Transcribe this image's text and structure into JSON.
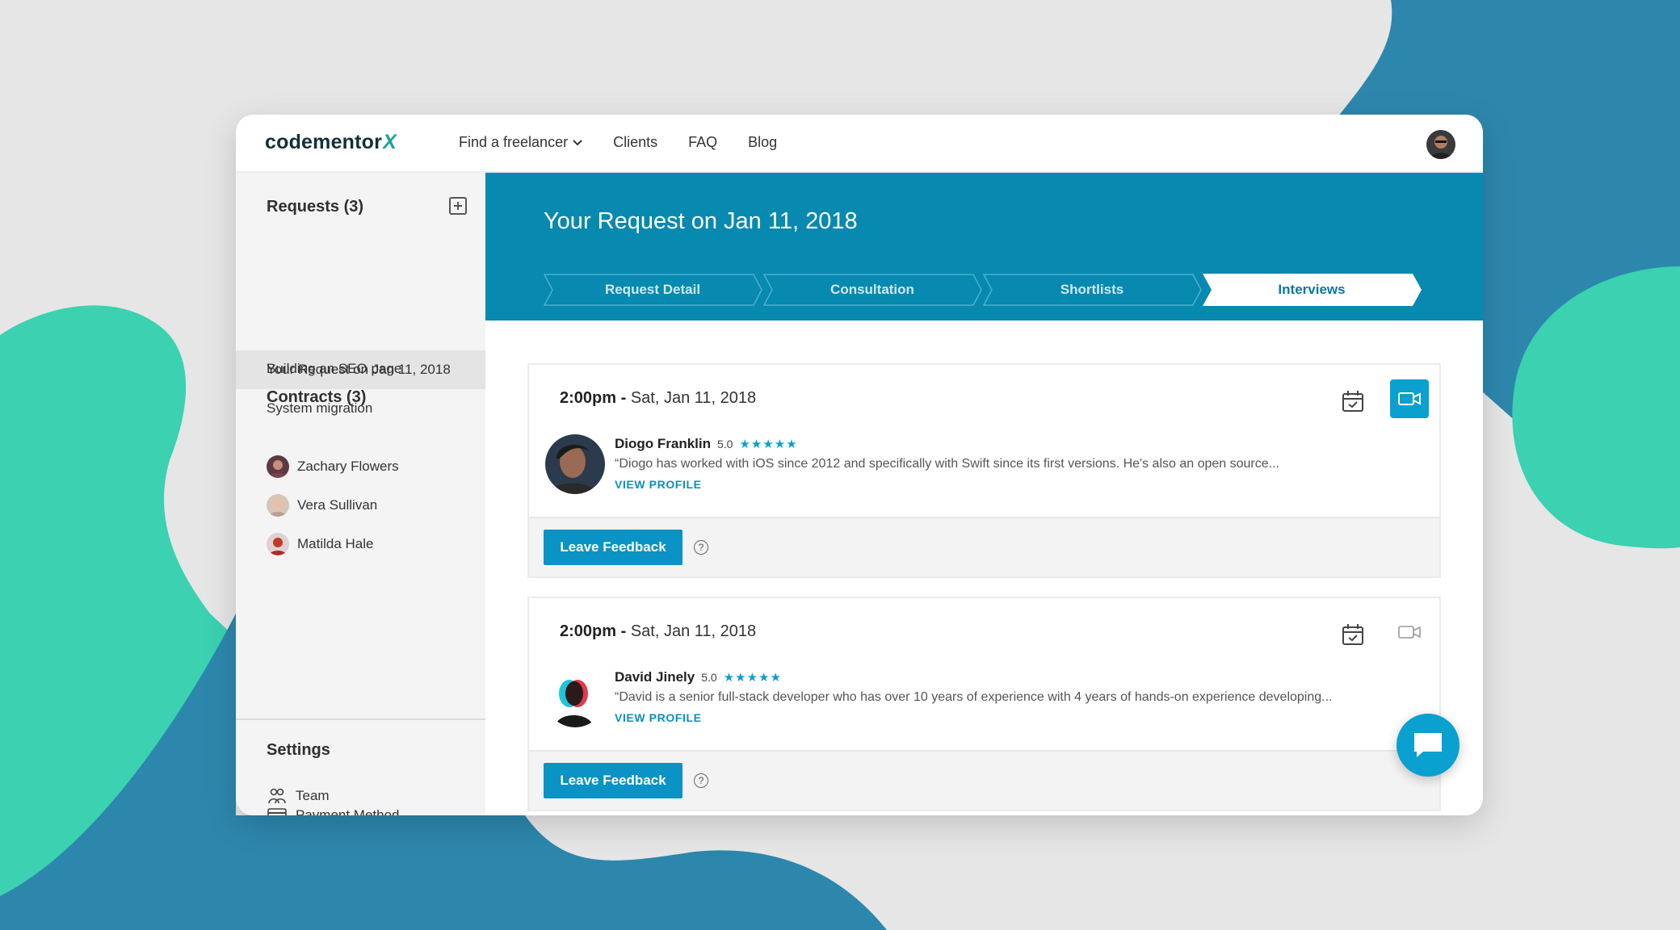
{
  "brand": {
    "logo_main": "codementor",
    "logo_accent": "X",
    "accent": "#0789b0"
  },
  "nav": {
    "items": [
      {
        "label": "Find a freelancer",
        "has_dropdown": true
      },
      {
        "label": "Clients"
      },
      {
        "label": "FAQ"
      },
      {
        "label": "Blog"
      }
    ]
  },
  "sidebar": {
    "requests_title": "Requests (3)",
    "requests": [
      {
        "label": "Your Request on Jan 11, 2018",
        "active": true
      },
      {
        "label": "Building an SEO page"
      },
      {
        "label": "System migration"
      }
    ],
    "contracts_title": "Contracts (3)",
    "contracts": [
      {
        "label": "Zachary Flowers"
      },
      {
        "label": "Vera Sullivan"
      },
      {
        "label": "Matilda Hale"
      }
    ],
    "settings_title": "Settings",
    "settings": [
      {
        "label": "Team",
        "icon": "team-icon"
      },
      {
        "label": "Payment Method",
        "icon": "credit-card-icon"
      }
    ]
  },
  "header": {
    "title": "Your Request on Jan 11, 2018",
    "steps": [
      "Request Detail",
      "Consultation",
      "Shortlists",
      "Interviews"
    ],
    "current_step": "Interviews"
  },
  "interviews": [
    {
      "time": "2:00pm -",
      "date": "Sat, Jan 11, 2018",
      "name": "Diogo Franklin",
      "rating": "5.0",
      "stars": "★★★★★",
      "quote": "“Diogo has worked with iOS since 2012 and specifically with Swift since its first versions. He's also an open source...",
      "view_profile": "VIEW PROFILE",
      "feedback_label": "Leave Feedback",
      "help": "?",
      "video_active": true
    },
    {
      "time": "2:00pm -",
      "date": "Sat, Jan 11, 2018",
      "name": "David Jinely",
      "rating": "5.0",
      "stars": "★★★★★",
      "quote": "“David is a senior full-stack developer who has over 10 years of experience with 4 years of hands-on experience developing...",
      "view_profile": "VIEW PROFILE",
      "feedback_label": "Leave Feedback",
      "help": "?",
      "video_active": false
    }
  ]
}
